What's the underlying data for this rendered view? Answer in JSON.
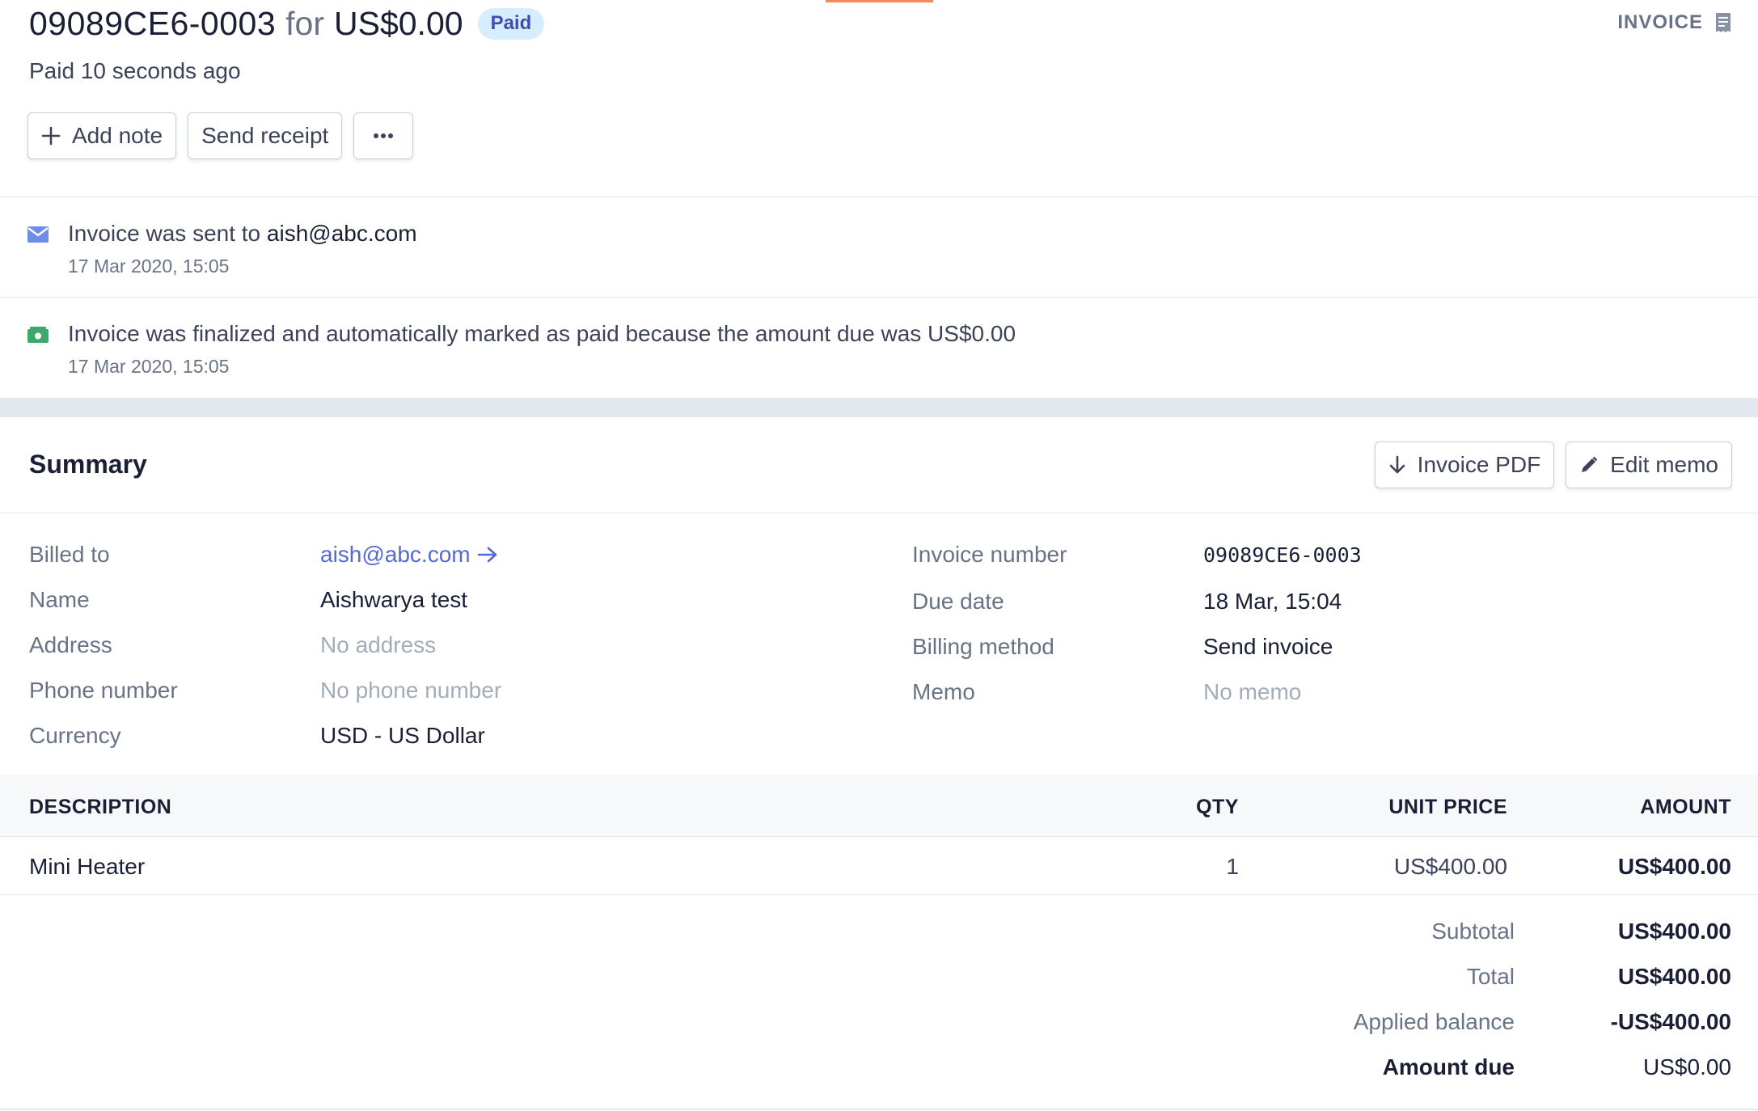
{
  "header": {
    "invoice_id": "09089CE6-0003",
    "for_text": "for",
    "amount": "US$0.00",
    "status_badge": "Paid",
    "paid_prefix": "Paid",
    "paid_ago": "10 seconds ago",
    "type_label": "INVOICE"
  },
  "actions": {
    "add_note": "Add note",
    "send_receipt": "Send receipt"
  },
  "timeline": [
    {
      "text": "Invoice was sent to",
      "highlight": "aish@abc.com",
      "time": "17 Mar 2020, 15:05",
      "icon": "mail-icon",
      "color": "#6c8ee6"
    },
    {
      "text": "Invoice was finalized and automatically marked as paid because the amount due was US$0.00",
      "highlight": "",
      "time": "17 Mar 2020, 15:05",
      "icon": "cash-icon",
      "color": "#3ea86b"
    }
  ],
  "summary": {
    "title": "Summary",
    "invoice_pdf": "Invoice PDF",
    "edit_memo": "Edit memo",
    "left": [
      {
        "label": "Billed to",
        "value": "aish@abc.com"
      },
      {
        "label": "Name",
        "value": "Aishwarya test"
      },
      {
        "label": "Address",
        "value": "No address"
      },
      {
        "label": "Phone number",
        "value": "No phone number"
      },
      {
        "label": "Currency",
        "value": "USD - US Dollar"
      }
    ],
    "right": [
      {
        "label": "Invoice number",
        "value": "09089CE6-0003"
      },
      {
        "label": "Due date",
        "value": "18 Mar, 15:04"
      },
      {
        "label": "Billing method",
        "value": "Send invoice"
      },
      {
        "label": "Memo",
        "value": "No memo"
      }
    ]
  },
  "items": {
    "headers": {
      "description": "DESCRIPTION",
      "qty": "QTY",
      "unit_price": "UNIT PRICE",
      "amount": "AMOUNT"
    },
    "rows": [
      {
        "description": "Mini Heater",
        "qty": "1",
        "unit_price": "US$400.00",
        "amount": "US$400.00"
      }
    ]
  },
  "totals": [
    {
      "label": "Subtotal",
      "value": "US$400.00"
    },
    {
      "label": "Total",
      "value": "US$400.00"
    },
    {
      "label": "Applied balance",
      "value": "-US$400.00"
    },
    {
      "label": "Amount due",
      "value": "US$0.00"
    }
  ],
  "colors": {
    "accent": "#5469d4",
    "badge_bg": "#d6ecff",
    "badge_text": "#3d4eac",
    "top_accent": "#f08a5d"
  }
}
